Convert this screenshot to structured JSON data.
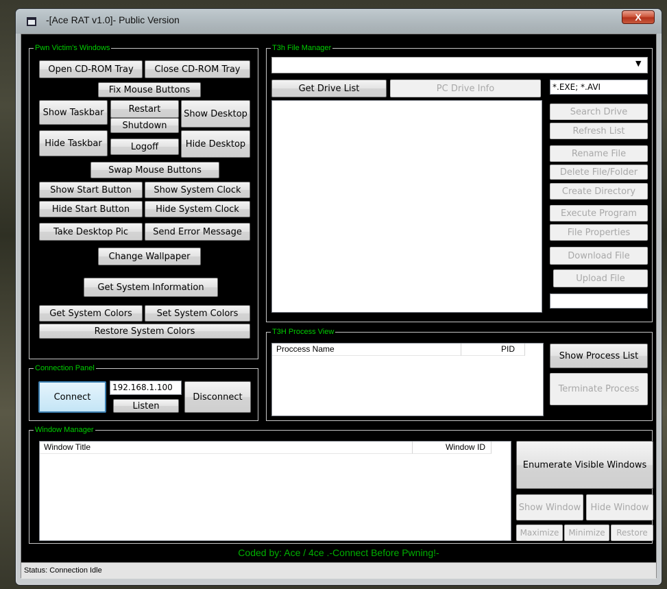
{
  "window": {
    "title": "-[Ace RAT v1.0]- Public Version",
    "close_label": "X"
  },
  "pwn": {
    "label": "Pwn Victim's Windows",
    "open_cd": "Open CD-ROM Tray",
    "close_cd": "Close CD-ROM Tray",
    "fix_mouse": "Fix Mouse Buttons",
    "show_taskbar": "Show Taskbar",
    "restart": "Restart",
    "show_desktop": "Show Desktop",
    "shutdown": "Shutdown",
    "hide_taskbar": "Hide Taskbar",
    "logoff": "Logoff",
    "hide_desktop": "Hide Desktop",
    "swap_mouse": "Swap Mouse Buttons",
    "show_start": "Show Start Button",
    "show_clock": "Show System Clock",
    "hide_start": "Hide Start Button",
    "hide_clock": "Hide System Clock",
    "take_pic": "Take Desktop Pic",
    "send_error": "Send Error Message",
    "change_wallpaper": "Change Wallpaper",
    "get_sysinfo": "Get System Information",
    "get_colors": "Get System Colors",
    "set_colors": "Set System Colors",
    "restore_colors": "Restore System Colors"
  },
  "connection": {
    "label": "Connection Panel",
    "connect": "Connect",
    "ip": "192.168.1.100",
    "listen": "Listen",
    "disconnect": "Disconnect"
  },
  "file_manager": {
    "label": "T3h File Manager",
    "drive_select": "",
    "get_drive_list": "Get Drive List",
    "pc_drive_info": "PC Drive Info",
    "filter": "*.EXE; *.AVI",
    "search_drive": "Search Drive",
    "refresh_list": "Refresh List",
    "rename_file": "Rename File",
    "delete_file": "Delete File/Folder",
    "create_dir": "Create Directory",
    "execute": "Execute Program",
    "properties": "File Properties",
    "download": "Download File",
    "upload": "Upload File",
    "path_value": ""
  },
  "process": {
    "label": "T3H Process View",
    "col_name": "Proccess Name",
    "col_pid": "PID",
    "show_list": "Show Process List",
    "terminate": "Terminate Process"
  },
  "window_manager": {
    "label": "Window Manager",
    "col_title": "Window Title",
    "col_id": "Window ID",
    "enumerate": "Enumerate Visible Windows",
    "show_window": "Show Window",
    "hide_window": "Hide Window",
    "maximize": "Maximize",
    "minimize": "Minimize",
    "restore": "Restore"
  },
  "footer": {
    "credit": "Coded by: Ace / 4ce .-Connect Before Pwning!-"
  },
  "status": {
    "text": "Status: Connection Idle"
  }
}
